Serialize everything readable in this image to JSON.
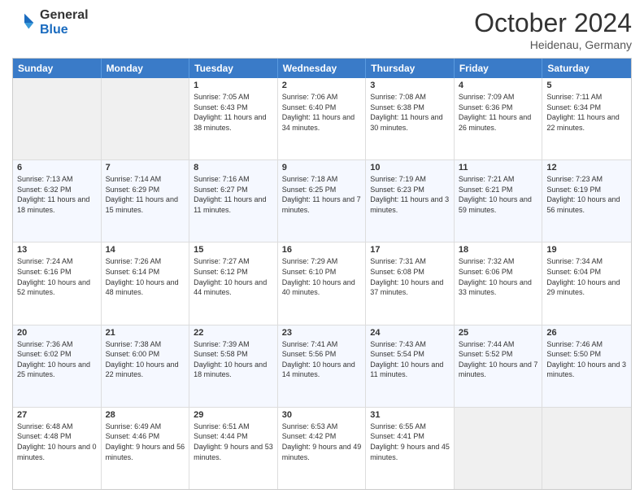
{
  "header": {
    "logo": {
      "general": "General",
      "blue": "Blue"
    },
    "title": "October 2024",
    "location": "Heidenau, Germany"
  },
  "days_of_week": [
    "Sunday",
    "Monday",
    "Tuesday",
    "Wednesday",
    "Thursday",
    "Friday",
    "Saturday"
  ],
  "weeks": [
    [
      {
        "day": "",
        "sunrise": "",
        "sunset": "",
        "daylight": ""
      },
      {
        "day": "",
        "sunrise": "",
        "sunset": "",
        "daylight": ""
      },
      {
        "day": "1",
        "sunrise": "Sunrise: 7:05 AM",
        "sunset": "Sunset: 6:43 PM",
        "daylight": "Daylight: 11 hours and 38 minutes."
      },
      {
        "day": "2",
        "sunrise": "Sunrise: 7:06 AM",
        "sunset": "Sunset: 6:40 PM",
        "daylight": "Daylight: 11 hours and 34 minutes."
      },
      {
        "day": "3",
        "sunrise": "Sunrise: 7:08 AM",
        "sunset": "Sunset: 6:38 PM",
        "daylight": "Daylight: 11 hours and 30 minutes."
      },
      {
        "day": "4",
        "sunrise": "Sunrise: 7:09 AM",
        "sunset": "Sunset: 6:36 PM",
        "daylight": "Daylight: 11 hours and 26 minutes."
      },
      {
        "day": "5",
        "sunrise": "Sunrise: 7:11 AM",
        "sunset": "Sunset: 6:34 PM",
        "daylight": "Daylight: 11 hours and 22 minutes."
      }
    ],
    [
      {
        "day": "6",
        "sunrise": "Sunrise: 7:13 AM",
        "sunset": "Sunset: 6:32 PM",
        "daylight": "Daylight: 11 hours and 18 minutes."
      },
      {
        "day": "7",
        "sunrise": "Sunrise: 7:14 AM",
        "sunset": "Sunset: 6:29 PM",
        "daylight": "Daylight: 11 hours and 15 minutes."
      },
      {
        "day": "8",
        "sunrise": "Sunrise: 7:16 AM",
        "sunset": "Sunset: 6:27 PM",
        "daylight": "Daylight: 11 hours and 11 minutes."
      },
      {
        "day": "9",
        "sunrise": "Sunrise: 7:18 AM",
        "sunset": "Sunset: 6:25 PM",
        "daylight": "Daylight: 11 hours and 7 minutes."
      },
      {
        "day": "10",
        "sunrise": "Sunrise: 7:19 AM",
        "sunset": "Sunset: 6:23 PM",
        "daylight": "Daylight: 11 hours and 3 minutes."
      },
      {
        "day": "11",
        "sunrise": "Sunrise: 7:21 AM",
        "sunset": "Sunset: 6:21 PM",
        "daylight": "Daylight: 10 hours and 59 minutes."
      },
      {
        "day": "12",
        "sunrise": "Sunrise: 7:23 AM",
        "sunset": "Sunset: 6:19 PM",
        "daylight": "Daylight: 10 hours and 56 minutes."
      }
    ],
    [
      {
        "day": "13",
        "sunrise": "Sunrise: 7:24 AM",
        "sunset": "Sunset: 6:16 PM",
        "daylight": "Daylight: 10 hours and 52 minutes."
      },
      {
        "day": "14",
        "sunrise": "Sunrise: 7:26 AM",
        "sunset": "Sunset: 6:14 PM",
        "daylight": "Daylight: 10 hours and 48 minutes."
      },
      {
        "day": "15",
        "sunrise": "Sunrise: 7:27 AM",
        "sunset": "Sunset: 6:12 PM",
        "daylight": "Daylight: 10 hours and 44 minutes."
      },
      {
        "day": "16",
        "sunrise": "Sunrise: 7:29 AM",
        "sunset": "Sunset: 6:10 PM",
        "daylight": "Daylight: 10 hours and 40 minutes."
      },
      {
        "day": "17",
        "sunrise": "Sunrise: 7:31 AM",
        "sunset": "Sunset: 6:08 PM",
        "daylight": "Daylight: 10 hours and 37 minutes."
      },
      {
        "day": "18",
        "sunrise": "Sunrise: 7:32 AM",
        "sunset": "Sunset: 6:06 PM",
        "daylight": "Daylight: 10 hours and 33 minutes."
      },
      {
        "day": "19",
        "sunrise": "Sunrise: 7:34 AM",
        "sunset": "Sunset: 6:04 PM",
        "daylight": "Daylight: 10 hours and 29 minutes."
      }
    ],
    [
      {
        "day": "20",
        "sunrise": "Sunrise: 7:36 AM",
        "sunset": "Sunset: 6:02 PM",
        "daylight": "Daylight: 10 hours and 25 minutes."
      },
      {
        "day": "21",
        "sunrise": "Sunrise: 7:38 AM",
        "sunset": "Sunset: 6:00 PM",
        "daylight": "Daylight: 10 hours and 22 minutes."
      },
      {
        "day": "22",
        "sunrise": "Sunrise: 7:39 AM",
        "sunset": "Sunset: 5:58 PM",
        "daylight": "Daylight: 10 hours and 18 minutes."
      },
      {
        "day": "23",
        "sunrise": "Sunrise: 7:41 AM",
        "sunset": "Sunset: 5:56 PM",
        "daylight": "Daylight: 10 hours and 14 minutes."
      },
      {
        "day": "24",
        "sunrise": "Sunrise: 7:43 AM",
        "sunset": "Sunset: 5:54 PM",
        "daylight": "Daylight: 10 hours and 11 minutes."
      },
      {
        "day": "25",
        "sunrise": "Sunrise: 7:44 AM",
        "sunset": "Sunset: 5:52 PM",
        "daylight": "Daylight: 10 hours and 7 minutes."
      },
      {
        "day": "26",
        "sunrise": "Sunrise: 7:46 AM",
        "sunset": "Sunset: 5:50 PM",
        "daylight": "Daylight: 10 hours and 3 minutes."
      }
    ],
    [
      {
        "day": "27",
        "sunrise": "Sunrise: 6:48 AM",
        "sunset": "Sunset: 4:48 PM",
        "daylight": "Daylight: 10 hours and 0 minutes."
      },
      {
        "day": "28",
        "sunrise": "Sunrise: 6:49 AM",
        "sunset": "Sunset: 4:46 PM",
        "daylight": "Daylight: 9 hours and 56 minutes."
      },
      {
        "day": "29",
        "sunrise": "Sunrise: 6:51 AM",
        "sunset": "Sunset: 4:44 PM",
        "daylight": "Daylight: 9 hours and 53 minutes."
      },
      {
        "day": "30",
        "sunrise": "Sunrise: 6:53 AM",
        "sunset": "Sunset: 4:42 PM",
        "daylight": "Daylight: 9 hours and 49 minutes."
      },
      {
        "day": "31",
        "sunrise": "Sunrise: 6:55 AM",
        "sunset": "Sunset: 4:41 PM",
        "daylight": "Daylight: 9 hours and 45 minutes."
      },
      {
        "day": "",
        "sunrise": "",
        "sunset": "",
        "daylight": ""
      },
      {
        "day": "",
        "sunrise": "",
        "sunset": "",
        "daylight": ""
      }
    ]
  ]
}
